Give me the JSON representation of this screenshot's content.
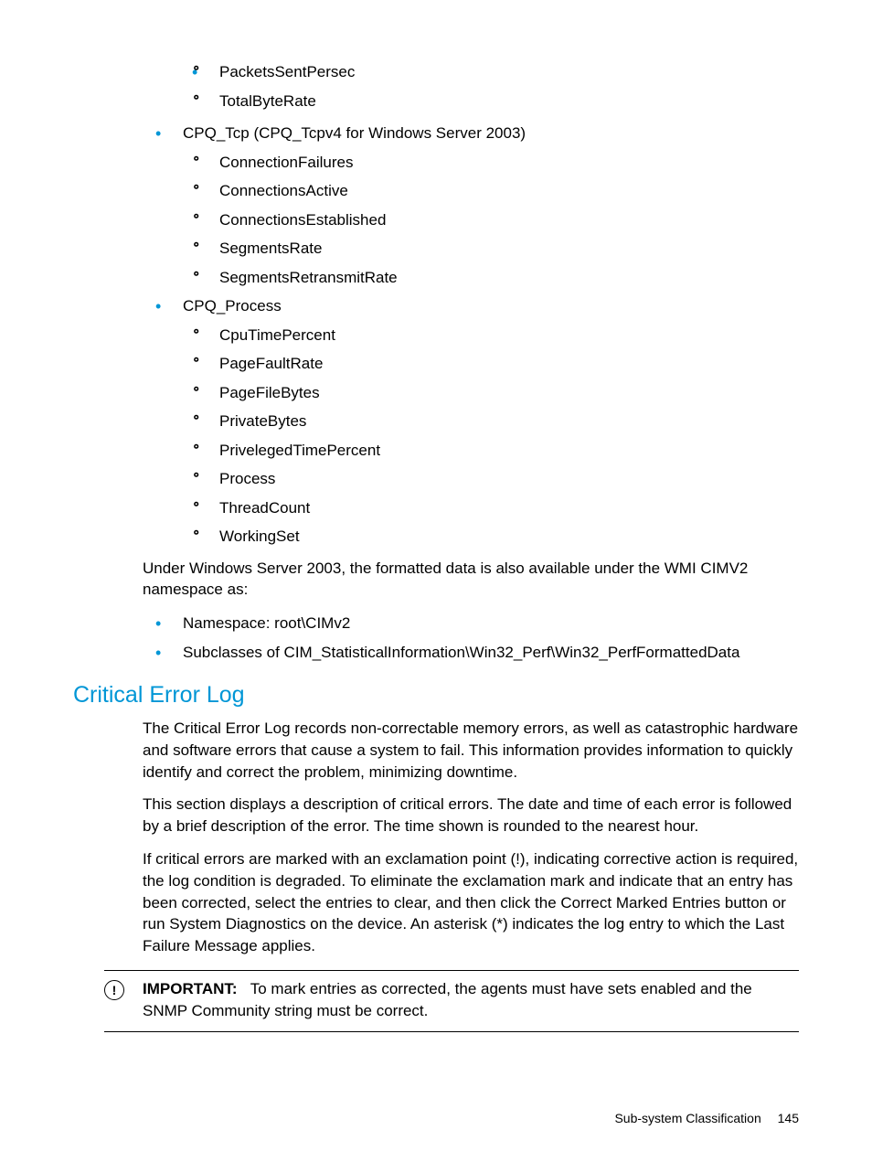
{
  "lists": {
    "top_orphans": [
      "PacketsSentPersec",
      "TotalByteRate"
    ],
    "bullet_cpq_tcp": "CPQ_Tcp (CPQ_Tcpv4 for Windows Server 2003)",
    "cpq_tcp_items": [
      "ConnectionFailures",
      "ConnectionsActive",
      "ConnectionsEstablished",
      "SegmentsRate",
      "SegmentsRetransmitRate"
    ],
    "bullet_cpq_process": "CPQ_Process",
    "cpq_process_items": [
      "CpuTimePercent",
      "PageFaultRate",
      "PageFileBytes",
      "PrivateBytes",
      "PrivelegedTimePercent",
      "Process",
      "ThreadCount",
      "WorkingSet"
    ]
  },
  "para_under": "Under Windows Server 2003, the formatted data is also available under the WMI CIMV2 namespace as:",
  "namespace_list": [
    "Namespace: root\\CIMv2",
    "Subclasses of CIM_StatisticalInformation\\Win32_Perf\\Win32_PerfFormattedData"
  ],
  "heading": "Critical Error Log",
  "crit_p1": "The Critical Error Log records non-correctable memory errors, as well as catastrophic hardware and software errors that cause a system to fail. This information provides information to quickly identify and correct the problem, minimizing downtime.",
  "crit_p2": "This section displays a description of critical errors. The date and time of each error is followed by a brief description of the error. The time shown is rounded to the nearest hour.",
  "crit_p3": "If critical errors are marked with an exclamation point (!), indicating corrective action is required, the log condition is degraded. To eliminate the exclamation mark and indicate that an entry has been corrected, select the entries to clear, and then click the Correct Marked Entries button or run System Diagnostics on the device. An asterisk (*) indicates the log entry to which the Last Failure Message applies.",
  "callout": {
    "label": "IMPORTANT:",
    "text": "To mark entries as corrected, the agents must have sets enabled and the SNMP Community string must be correct."
  },
  "footer": {
    "section": "Sub-system Classification",
    "page": "145"
  }
}
